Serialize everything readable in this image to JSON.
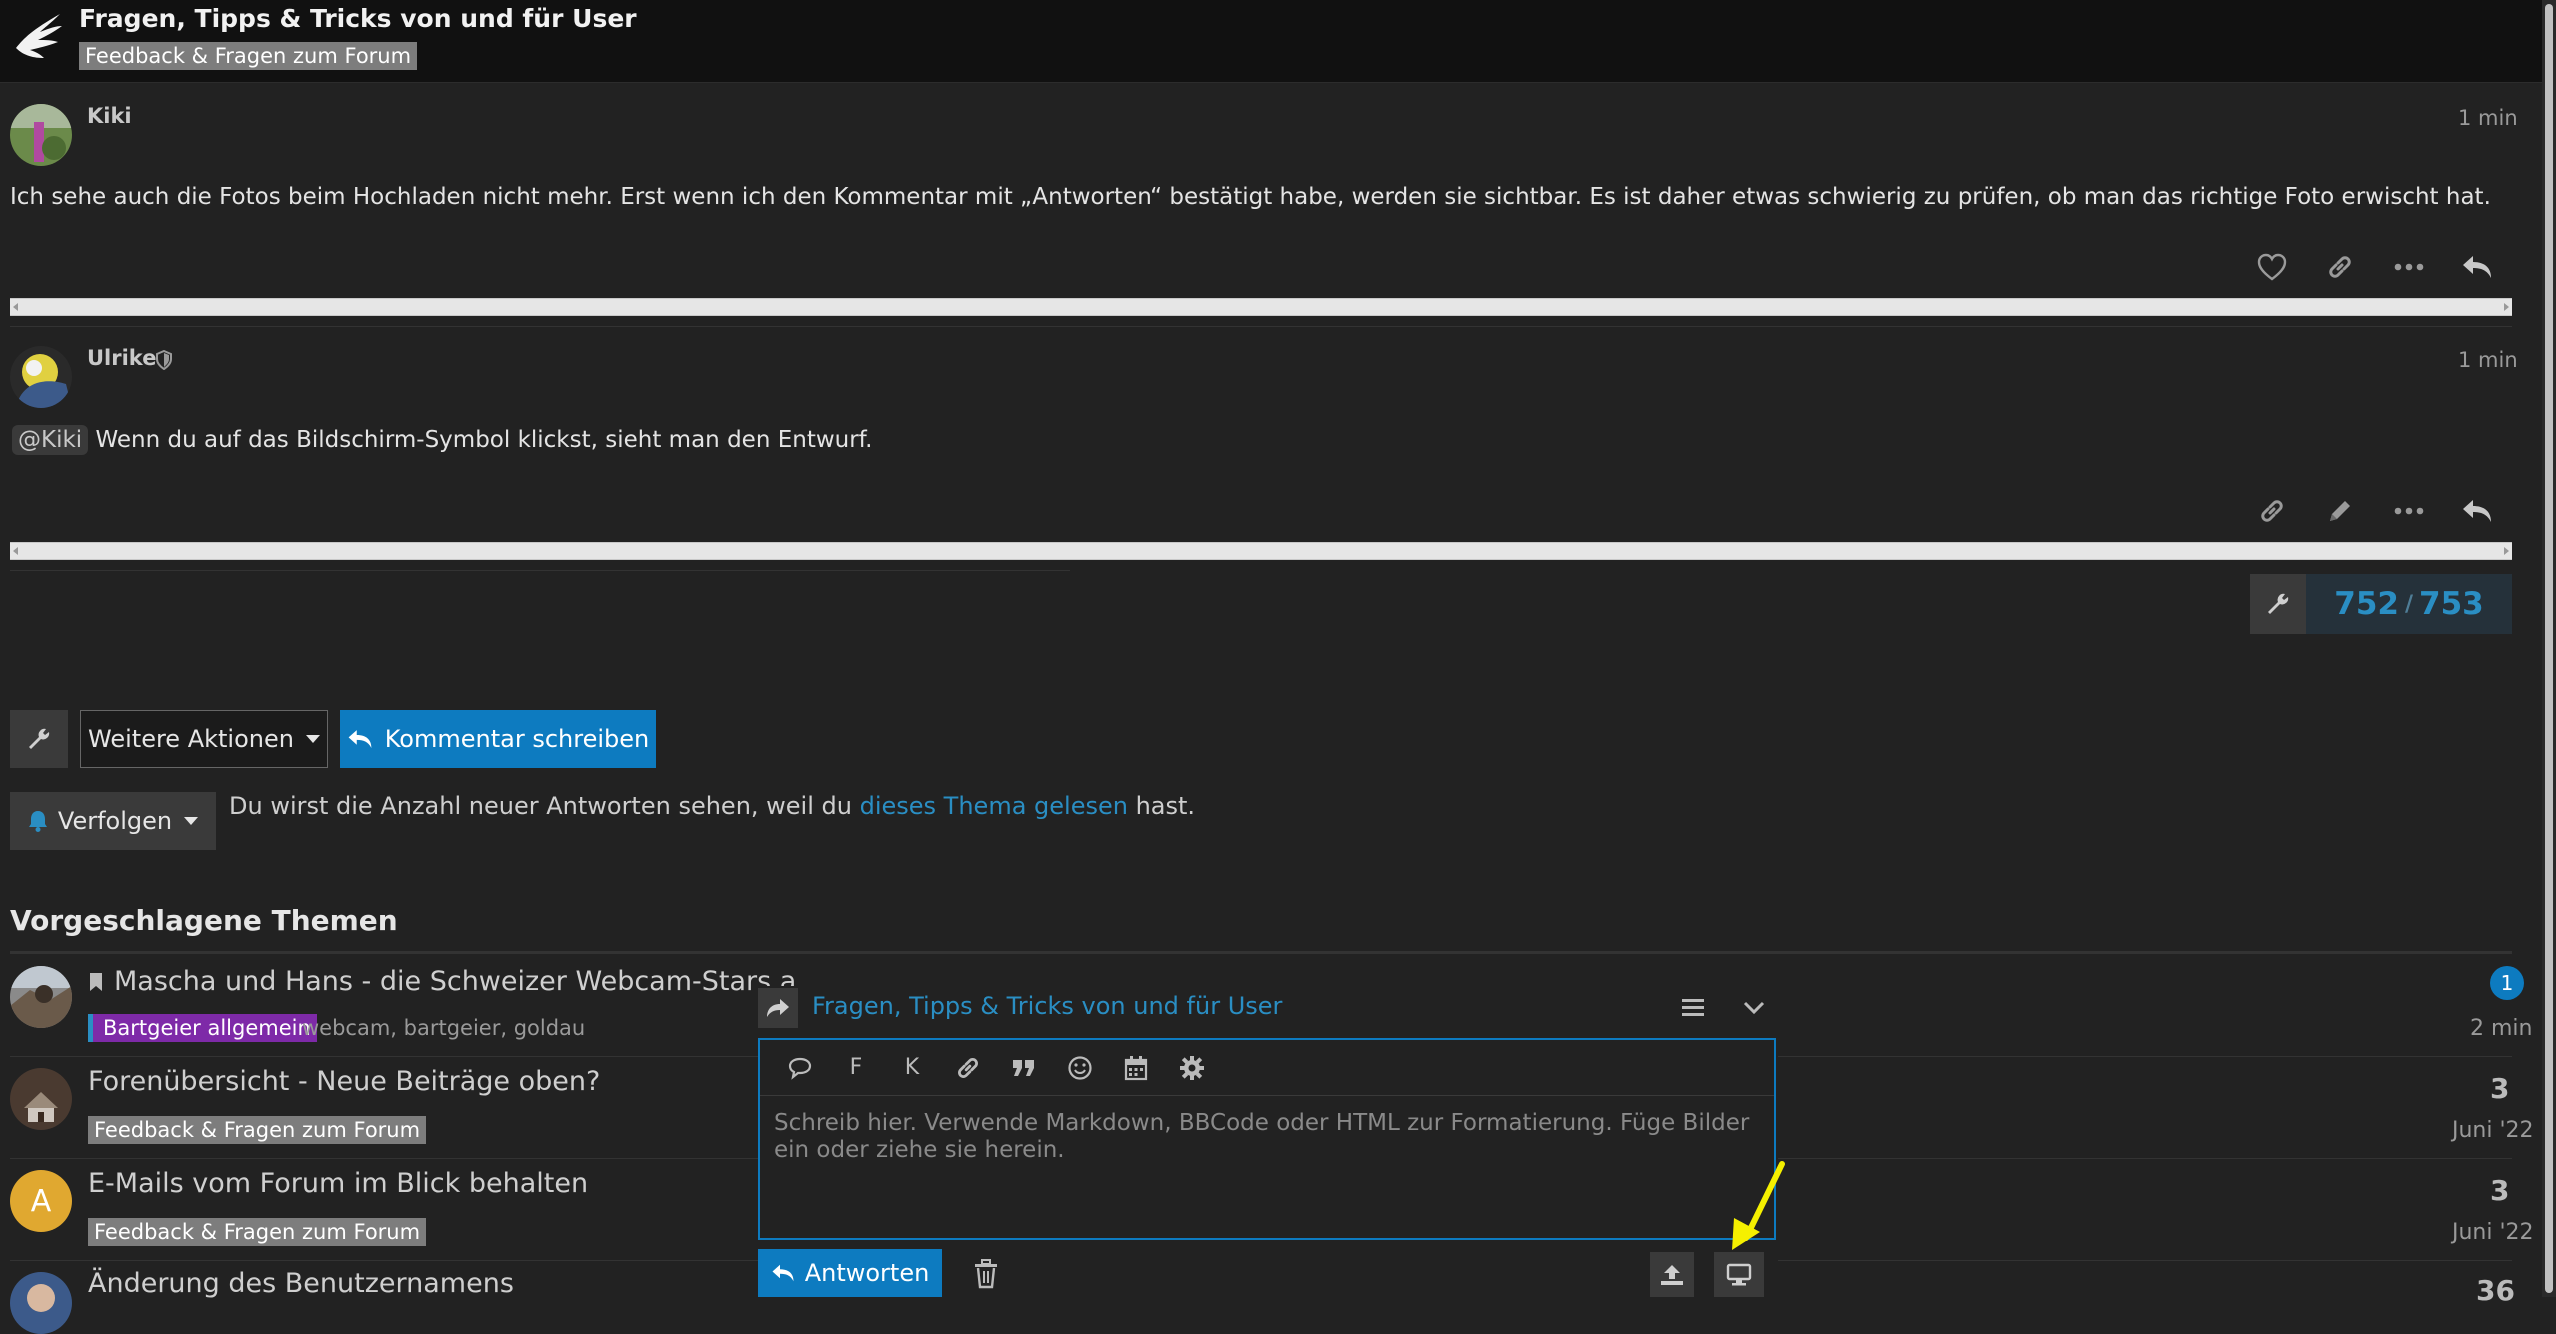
{
  "header": {
    "title": "Fragen, Tipps & Tricks von und für User",
    "category": "Feedback & Fragen zum Forum"
  },
  "posts": [
    {
      "user": "Kiki",
      "time": "1 min",
      "body": "Ich sehe auch die Fotos beim Hochladen nicht mehr. Erst wenn ich den Kommentar mit „Antworten“ bestätigt habe, werden sie sichtbar. Es ist daher etwas schwierig zu prüfen, ob man das richtige Foto erwischt hat."
    },
    {
      "user": "Ulrike",
      "time": "1 min",
      "mention": "@Kiki",
      "body": "Wenn du auf das Bildschirm-Symbol klickst, sieht man den Entwurf."
    }
  ],
  "timeline": {
    "current": "752",
    "separator": "/",
    "total": "753"
  },
  "topic_buttons": {
    "more_actions": "Weitere Aktionen",
    "reply": "Kommentar schreiben",
    "follow": "Verfolgen"
  },
  "notice": {
    "before": "Du wirst die Anzahl neuer Antworten sehen, weil du",
    "link": "dieses Thema gelesen",
    "after": "hast."
  },
  "suggested": {
    "title": "Vorgeschlagene Themen",
    "topics": [
      {
        "title": "Mascha und Hans - die Schweizer Webcam-Stars a",
        "category": "Bartgeier allgemein",
        "tags": "webcam, bartgeier, goldau",
        "unread": "1",
        "date": "2 min"
      },
      {
        "title": "Forenübersicht - Neue Beiträge oben?",
        "category": "Feedback & Fragen zum Forum",
        "count": "3",
        "date": "Juni '22"
      },
      {
        "title": "E-Mails vom Forum im Blick behalten",
        "category": "Feedback & Fragen zum Forum",
        "avatar_letter": "A",
        "count": "3",
        "date": "Juni '22"
      },
      {
        "title": "Änderung des Benutzernamens",
        "count": "36"
      }
    ]
  },
  "composer": {
    "title": "Fragen, Tipps & Tricks von und für User",
    "toolbar": {
      "bold": "F",
      "italic": "K"
    },
    "placeholder": "Schreib hier. Verwende Markdown, BBCode oder HTML zur Formatierung. Füge Bilder ein oder ziehe sie herein.",
    "submit": "Antworten"
  },
  "colors": {
    "accent": "#0d7bc0",
    "link": "#2a8ec3",
    "category_purple": "#7e2aa8",
    "annotation_arrow": "#f5f000"
  },
  "icons": {
    "logo": "bird-icon",
    "post_actions": [
      "heart-icon",
      "link-icon",
      "ellipsis-icon",
      "reply-icon"
    ],
    "composer_toolbar": [
      "speech-bubble-icon",
      "link-icon",
      "quote-icon",
      "emoji-icon",
      "calendar-icon",
      "gear-icon"
    ]
  }
}
